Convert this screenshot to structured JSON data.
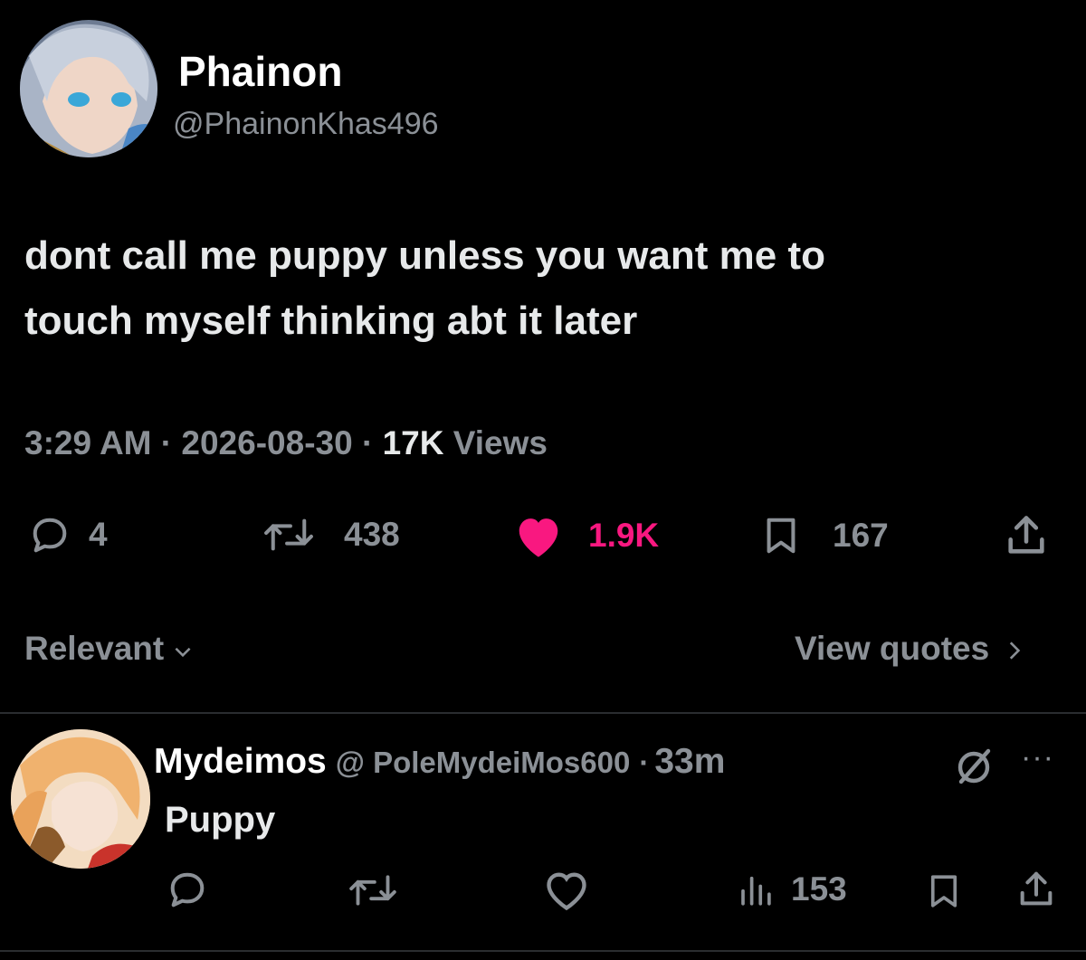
{
  "main_post": {
    "display_name": "Phainon",
    "handle": "@PhainonKhas496",
    "text_line1": "dont call me puppy unless you want me to",
    "text_line2": "touch myself thinking abt it later",
    "time": "3:29 AM",
    "date": "2026-08-30",
    "views_count": "17K",
    "views_label": "Views",
    "replies": "4",
    "reposts": "438",
    "likes": "1.9K",
    "bookmarks": "167",
    "like_color": "#f91880"
  },
  "sort": {
    "label": "Relevant",
    "quotes_label": "View quotes"
  },
  "reply": {
    "display_name": "Mydeimos",
    "handle": "@ PoleMydeiMos600",
    "age": "33m",
    "text": "Puppy",
    "views": "153"
  },
  "icons": [
    "reply-icon",
    "repost-icon",
    "heart-icon",
    "bookmark-icon",
    "share-icon",
    "chevron-down-icon",
    "chevron-right-icon",
    "grok-icon",
    "more-icon",
    "views-icon"
  ]
}
